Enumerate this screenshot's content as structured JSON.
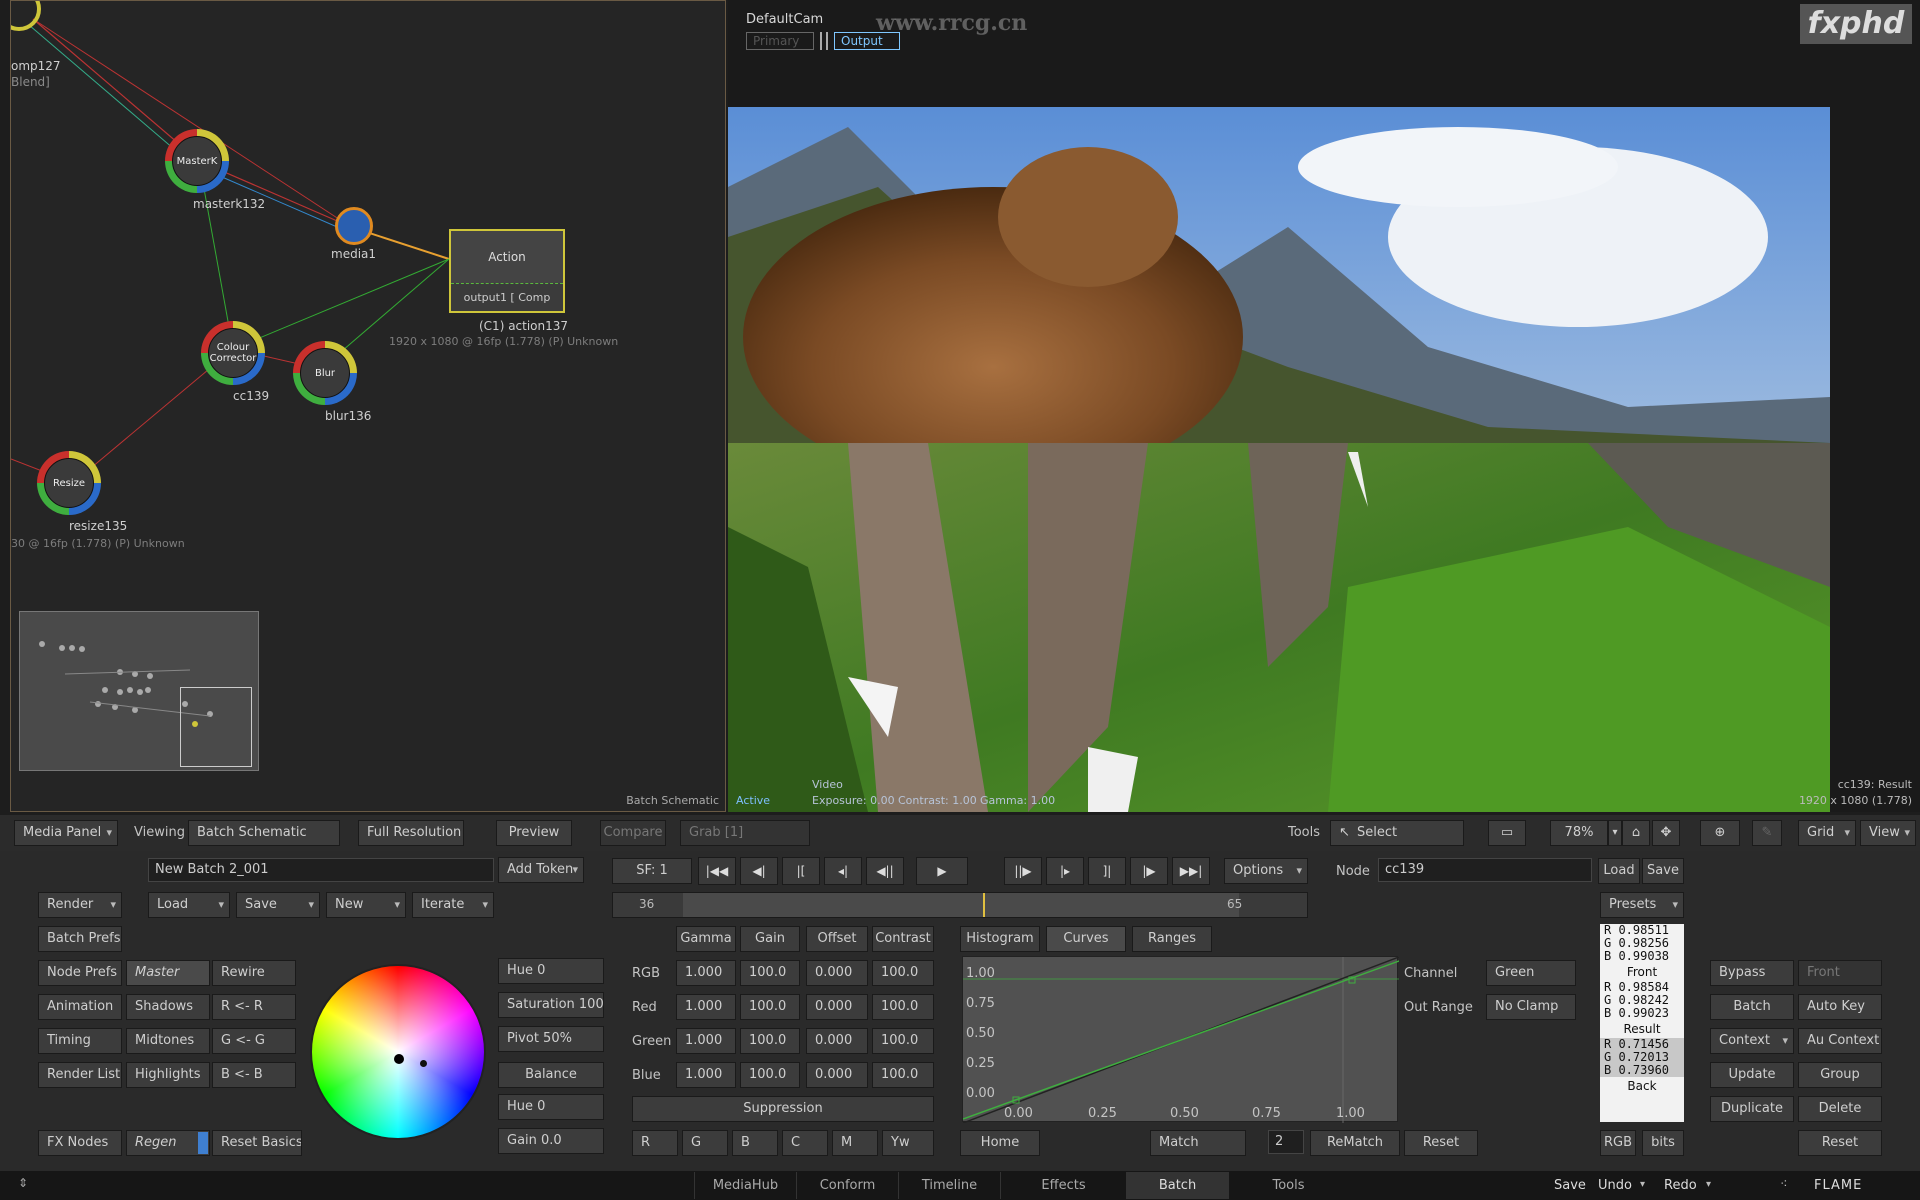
{
  "schematic": {
    "nodes": {
      "comp_label": "omp127",
      "comp_sub": "Blend]",
      "masterk_inner": "MasterK",
      "masterk_label": "masterk132",
      "media_label": "media1",
      "action_title": "Action",
      "action_output": "output1 [ Comp",
      "action_label": "(C1) action137",
      "action_res": "1920 x 1080 @ 16fp (1.778) (P) Unknown",
      "cc_inner": "Colour Corrector",
      "cc_label": "cc139",
      "blur_inner": "Blur",
      "blur_label": "blur136",
      "resize_inner": "Resize",
      "resize_label": "resize135",
      "resize_res": "30 @ 16fp (1.778) (P) Unknown"
    },
    "footer": "Batch Schematic"
  },
  "viewer": {
    "camera": "DefaultCam",
    "tab_primary": "Primary",
    "tab_output": "Output",
    "watermark_url": "www.rrcg.cn",
    "brand_logo": "fxphd",
    "status_active": "Active",
    "video_label": "Video",
    "exposure": "Exposure: 0.00",
    "contrast": "Contrast: 1.00",
    "gamma": "Gamma: 1.00",
    "result_label": "cc139: Result",
    "result_res": "1920 x 1080 (1.778)"
  },
  "toolbar": {
    "media_panel": "Media Panel",
    "viewing_label": "Viewing",
    "viewing_value": "Batch Schematic",
    "full_resolution": "Full Resolution",
    "preview": "Preview",
    "compare": "Compare",
    "grab": "Grab [1]",
    "tools_label": "Tools",
    "select": "Select",
    "zoom": "78%",
    "grid": "Grid",
    "view": "View"
  },
  "batch": {
    "name": "New Batch 2_001",
    "add_token": "Add Token",
    "render": "Render",
    "load": "Load",
    "save": "Save",
    "new": "New",
    "iterate": "Iterate",
    "batch_prefs": "Batch Prefs",
    "node_prefs": "Node Prefs",
    "animation": "Animation",
    "timing": "Timing",
    "render_list": "Render List",
    "fx_nodes": "FX Nodes",
    "regen": "Regen"
  },
  "transport": {
    "sf": "SF: 1",
    "options": "Options",
    "frame_in": "36",
    "frame_out": "65",
    "node_label": "Node",
    "node_value": "cc139",
    "load": "Load",
    "save": "Save"
  },
  "color_corrector": {
    "ranges": [
      "Master",
      "Shadows",
      "Midtones",
      "Highlights"
    ],
    "rewire": [
      "Rewire",
      "R <- R",
      "G <- G",
      "B <- B"
    ],
    "reset_basics": "Reset Basics",
    "hue": "Hue 0",
    "saturation": "Saturation 100",
    "pivot": "Pivot 50%",
    "balance": "Balance",
    "hue2": "Hue 0",
    "gain": "Gain 0.0",
    "columns": [
      "Gamma",
      "Gain",
      "Offset",
      "Contrast"
    ],
    "rows": [
      {
        "label": "RGB",
        "values": [
          "1.000",
          "100.0",
          "0.000",
          "100.0"
        ]
      },
      {
        "label": "Red",
        "values": [
          "1.000",
          "100.0",
          "0.000",
          "100.0"
        ]
      },
      {
        "label": "Green",
        "values": [
          "1.000",
          "100.0",
          "0.000",
          "100.0"
        ]
      },
      {
        "label": "Blue",
        "values": [
          "1.000",
          "100.0",
          "0.000",
          "100.0"
        ]
      }
    ],
    "suppression": "Suppression",
    "channels": [
      "R",
      "G",
      "B",
      "C",
      "M",
      "Yw"
    ]
  },
  "curves": {
    "tabs": [
      "Histogram",
      "Curves",
      "Ranges"
    ],
    "y_ticks": [
      "1.00",
      "0.75",
      "0.50",
      "0.25",
      "0.00"
    ],
    "x_ticks": [
      "0.00",
      "0.25",
      "0.50",
      "0.75",
      "1.00"
    ],
    "channel_label": "Channel",
    "channel_value": "Green",
    "out_range_label": "Out Range",
    "out_range_value": "No Clamp",
    "home": "Home",
    "match": "Match",
    "match_value": "2",
    "rematch": "ReMatch",
    "reset": "Reset"
  },
  "result_box": {
    "presets": "Presets",
    "top_rows": [
      "R  0.98511",
      "G  0.98256",
      "B  0.99038"
    ],
    "front": "Front",
    "mid_rows": [
      "R  0.98584",
      "G  0.98242",
      "B  0.99023"
    ],
    "result": "Result",
    "bottom_rows": [
      "R  0.71456",
      "G  0.72013",
      "B  0.73960"
    ],
    "back": "Back",
    "rgb": "RGB",
    "bits": "bits"
  },
  "right_actions": {
    "bypass": "Bypass",
    "front": "Front",
    "batch": "Batch",
    "auto_key": "Auto Key",
    "context": "Context",
    "au_context": "Au Context",
    "update": "Update",
    "group": "Group",
    "duplicate": "Duplicate",
    "delete": "Delete",
    "reset": "Reset"
  },
  "bottom_bar": {
    "tabs": [
      "MediaHub",
      "Conform",
      "Timeline",
      "Effects",
      "Batch",
      "Tools"
    ],
    "save": "Save",
    "undo": "Undo",
    "redo": "Redo",
    "app": "FLAME"
  }
}
